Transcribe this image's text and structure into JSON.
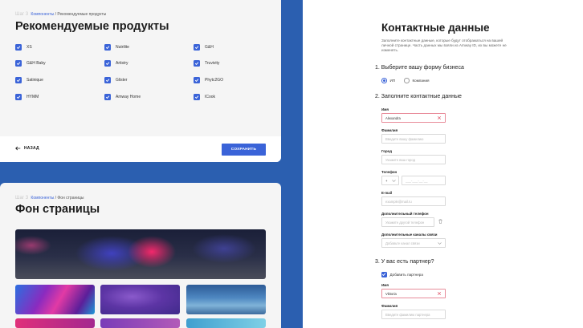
{
  "card1": {
    "breadcrumb": {
      "step": "Шаг 3",
      "link": "Компоненты",
      "current": "/ Рекомендуемые продукты"
    },
    "title": "Рекомендуемые продукты",
    "products": [
      {
        "label": "XS",
        "checked": true
      },
      {
        "label": "Nutrilite",
        "checked": true
      },
      {
        "label": "G&H",
        "checked": true
      },
      {
        "label": "G&H Baby",
        "checked": true
      },
      {
        "label": "Artistry",
        "checked": true
      },
      {
        "label": "Truvivity",
        "checked": true
      },
      {
        "label": "Satinique",
        "checked": true
      },
      {
        "label": "Glister",
        "checked": true
      },
      {
        "label": "Phytc2GO",
        "checked": true
      },
      {
        "label": "HYMM",
        "checked": true
      },
      {
        "label": "Amway Home",
        "checked": true
      },
      {
        "label": "ICook",
        "checked": true
      }
    ],
    "back_label": "НАЗАД",
    "save_label": "СОХРАНИТЬ"
  },
  "card2": {
    "breadcrumb": {
      "step": "Шаг 3",
      "link": "Компоненты",
      "current": "/ Фон страницы"
    },
    "title": "Фон страницы"
  },
  "card3": {
    "title": "Контактные данные",
    "intro": "Заполните контактные данные, которые будут отображаться на вашей личной странице. Часть данных мы взяли из Amway ID, их вы можете не изменять.",
    "section1": "1. Выберите вашу форму бизнеса",
    "business_types": [
      {
        "label": "ИП",
        "selected": true
      },
      {
        "label": "Компания",
        "selected": false
      }
    ],
    "section2": "2. Заполните контактные данные",
    "fields": {
      "first_name": {
        "label": "Имя",
        "value": "Alexandra",
        "placeholder": ""
      },
      "last_name": {
        "label": "Фамилия",
        "value": "",
        "placeholder": "Введите вашу фамилию"
      },
      "city": {
        "label": "Город",
        "value": "",
        "placeholder": "Укажите ваш город"
      },
      "phone": {
        "label": "Телефон",
        "code": "+",
        "placeholder": "___-___-__-__"
      },
      "email": {
        "label": "E-mail",
        "value": "",
        "placeholder": "example@mail.ru"
      },
      "extra_phone": {
        "label": "Дополнительный телефон",
        "value": "",
        "placeholder": "Укажите другой телефон"
      },
      "extra_channels": {
        "label": "Дополнительные каналы связи",
        "value": "",
        "placeholder": "Добавьте канал связи"
      }
    },
    "section3": "3. У вас есть партнер?",
    "add_partner_label": "Добавить партнера",
    "partner_fields": {
      "first_name": {
        "label": "Имя",
        "value": "Viktoria"
      },
      "last_name": {
        "label": "Фамилия",
        "placeholder": "Введите фамилию партнера"
      }
    }
  },
  "colors": {
    "accent": "#3a63d8",
    "background": "#2b5fb0",
    "error": "#e88c9a"
  }
}
